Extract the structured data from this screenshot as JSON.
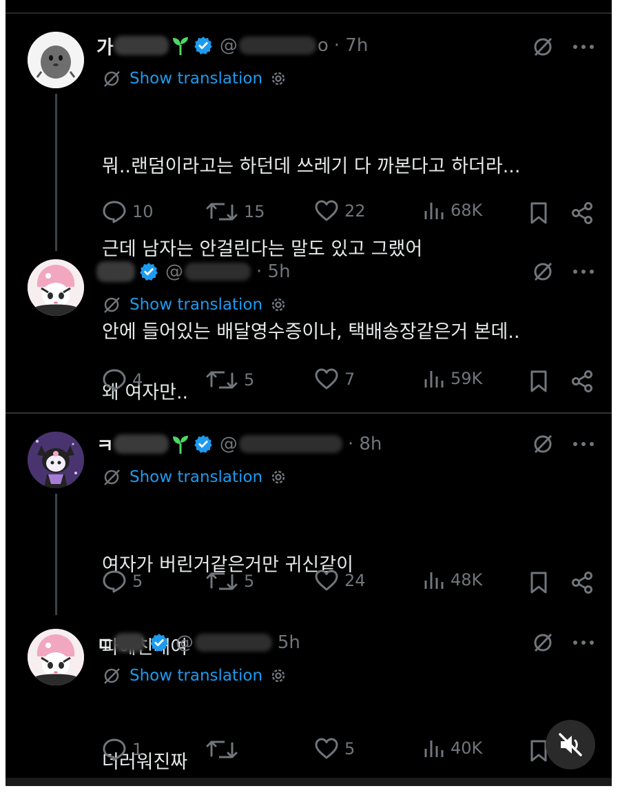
{
  "colors": {
    "background": "#000000",
    "text": "#e7e9ea",
    "muted": "#71767b",
    "link": "#1d9bf0",
    "verified": "#1d9bf0",
    "sprout": "#4cd964"
  },
  "tweets": [
    {
      "name_visible": "가",
      "name_tail": "",
      "handle_prefix": "@",
      "handle_tail": "o",
      "time": "· 7h",
      "translate_label": "Show translation",
      "lines": [
        "뭐..랜덤이라고는 하던데 쓰레기 다 까본다고 하더라...",
        "근데 남자는 안걸린다는 말도 있고 그랬어",
        "안에 들어있는 배달영수증이나, 택배송장같은거 본데.."
      ],
      "replies": "10",
      "reposts": "15",
      "likes": "22",
      "views": "68K",
      "avatar_icon": "gray-rock-avatar"
    },
    {
      "name_visible": "",
      "name_tail": "",
      "handle_prefix": "@",
      "handle_tail": "",
      "time": "· 5h",
      "translate_label": "Show translation",
      "lines": [
        "왜 여자만.."
      ],
      "replies": "4",
      "reposts": "5",
      "likes": "7",
      "views": "59K",
      "avatar_icon": "kuromi-pink-avatar"
    },
    {
      "name_visible": "ㅋ",
      "name_tail": "",
      "handle_prefix": "@",
      "handle_tail": "",
      "time": "· 8h",
      "translate_label": "Show translation",
      "lines": [
        "여자가 버린거같은거만 귀신같이",
        "파헤친대여"
      ],
      "replies": "5",
      "reposts": "5",
      "likes": "24",
      "views": "48K",
      "avatar_icon": "kuromi-purple-avatar"
    },
    {
      "name_visible": "ㄷ",
      "name_tail": "",
      "handle_prefix": "@",
      "handle_tail": "",
      "time": "5h",
      "translate_label": "Show translation",
      "lines": [
        "더러워진짜"
      ],
      "replies": "1",
      "reposts": "",
      "likes": "5",
      "views": "40K",
      "avatar_icon": "kuromi-pink-avatar"
    }
  ]
}
